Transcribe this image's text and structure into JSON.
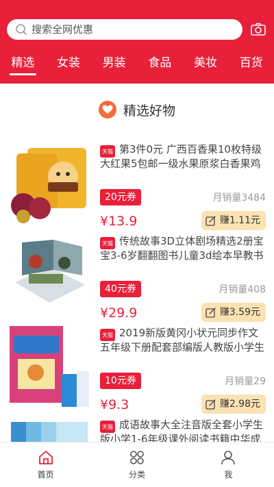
{
  "search": {
    "placeholder": "搜索全网优惠"
  },
  "tabs": [
    {
      "label": "精选",
      "active": true
    },
    {
      "label": "女装"
    },
    {
      "label": "男装"
    },
    {
      "label": "食品"
    },
    {
      "label": "美妆"
    },
    {
      "label": "百货"
    }
  ],
  "section": {
    "title": "精选好物"
  },
  "products": [
    {
      "badge": "天猫",
      "name": "第3件0元 广西百香果10枚特级大红果5包邮一级水果原浆白香果鸡蛋果",
      "coupon": "20元券",
      "sales": "月销量3484",
      "price": "¥13.9",
      "earn": "赚1.11元"
    },
    {
      "badge": "天猫",
      "name": "传统故事3D立体剧场精选2册宝宝3-6岁翻翻图书儿童3d绘本早教书",
      "coupon": "40元券",
      "sales": "月销量408",
      "price": "¥29.9",
      "earn": "赚3.59元"
    },
    {
      "badge": "天猫",
      "name": "2019新版黄冈小状元同步作文五年级下册配套部编版人教版小学生作文书",
      "coupon": "10元券",
      "sales": "月销量29",
      "price": "¥9.3",
      "earn": "赚2.98元"
    },
    {
      "badge": "天猫",
      "name": "成语故事大全注音版全套小学生版小学1-6年级课外阅读书籍中华成语",
      "coupon": "",
      "sales": "",
      "price": "",
      "earn": ""
    }
  ],
  "bottom_nav": [
    {
      "label": "首页",
      "icon": "home-icon",
      "active": true
    },
    {
      "label": "分类",
      "icon": "category-icon"
    },
    {
      "label": "我",
      "icon": "user-icon"
    }
  ],
  "colors": {
    "brand": "#e8203a",
    "earn_bg": "#fbe2b2",
    "heart": "#f36b3a"
  }
}
